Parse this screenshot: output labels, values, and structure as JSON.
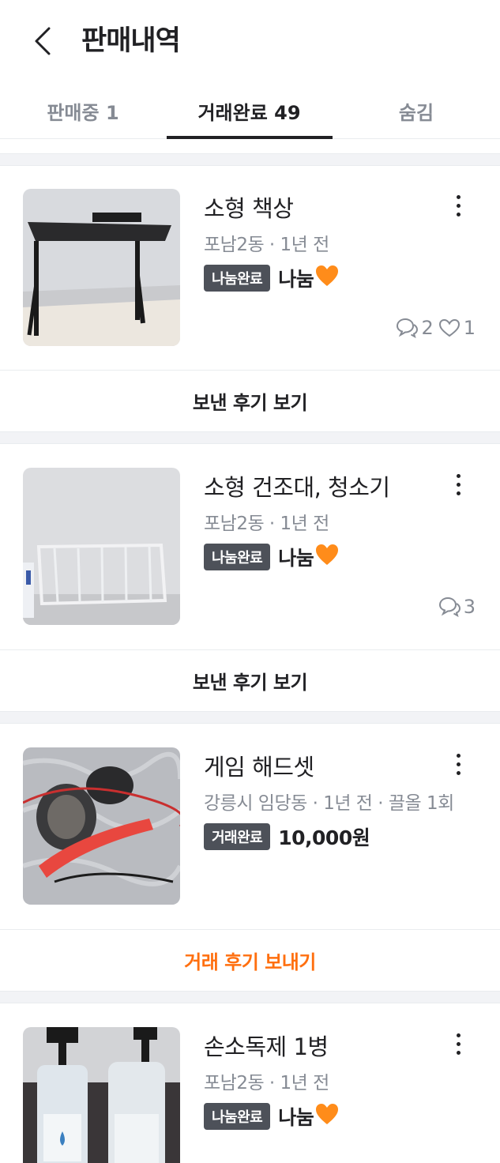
{
  "header": {
    "title": "판매내역"
  },
  "tabs": [
    {
      "label": "판매중 1"
    },
    {
      "label": "거래완료 49"
    },
    {
      "label": "숨김"
    }
  ],
  "items": [
    {
      "title": "소형 책상",
      "meta": "포남2동 · 1년 전",
      "badge": "나눔완료",
      "price": "나눔",
      "chats": "2",
      "likes": "1",
      "review_label": "보낸 후기 보기"
    },
    {
      "title": "소형 건조대, 청소기",
      "meta": "포남2동 · 1년 전",
      "badge": "나눔완료",
      "price": "나눔",
      "chats": "3",
      "review_label": "보낸 후기 보기"
    },
    {
      "title": "게임 해드셋",
      "meta": "강릉시 임당동 · 1년 전 · 끌올 1회",
      "badge": "거래완료",
      "price": "10,000원",
      "review_label": "거래 후기 보내기"
    },
    {
      "title": "손소독제 1병",
      "meta": "포남2동 · 1년 전",
      "badge": "나눔완료",
      "price": "나눔"
    }
  ],
  "colors": {
    "accent": "#ff6f0f",
    "badge_bg": "#4d5159",
    "muted": "#868b94"
  }
}
